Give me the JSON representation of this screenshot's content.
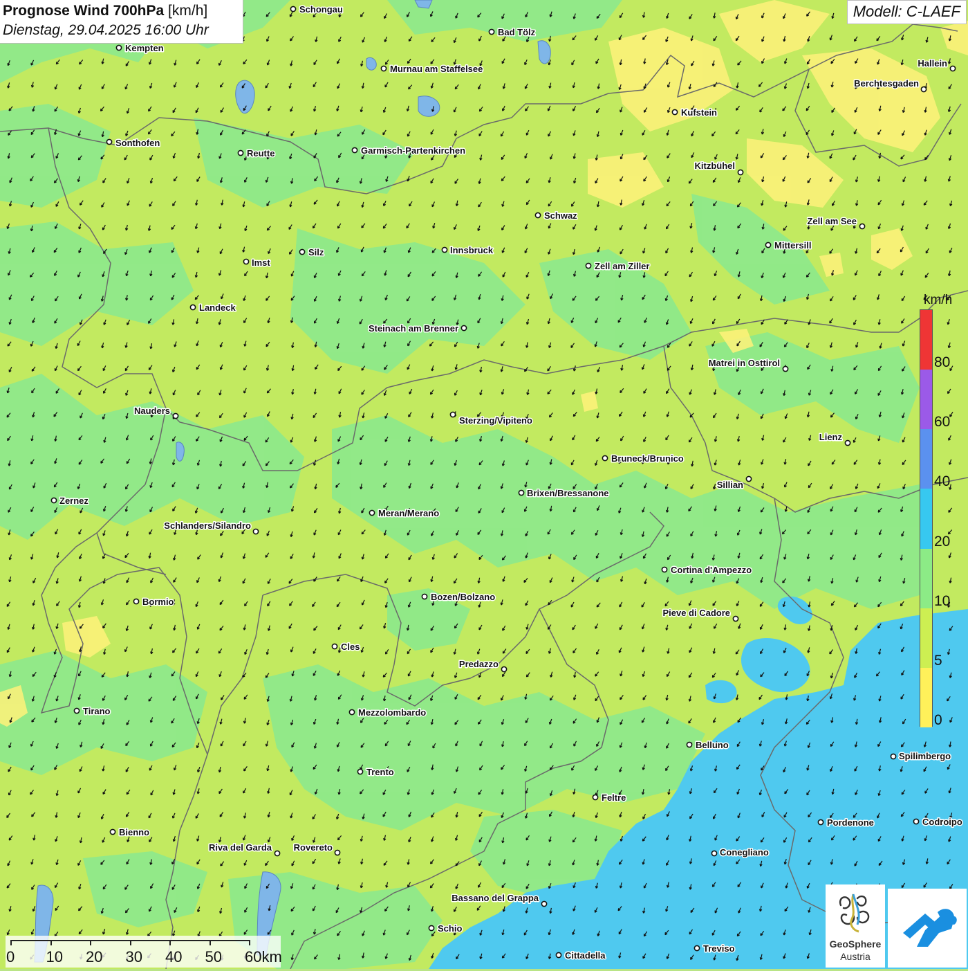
{
  "header": {
    "title_bold": "Prognose Wind 700hPa",
    "title_unit": "[km/h]",
    "datetime": "Dienstag, 29.04.2025 16:00 Uhr",
    "model": "Modell: C-LAEF"
  },
  "legend": {
    "unit": "km/h",
    "ticks": [
      "0",
      "5",
      "10",
      "20",
      "40",
      "60",
      "80"
    ],
    "colors": [
      "#fff15a",
      "#cdef52",
      "#8ceb86",
      "#37c8f0",
      "#5b91ef",
      "#9b5ae8",
      "#ef3535"
    ]
  },
  "scalebar": {
    "labels": [
      "0",
      "10",
      "20",
      "30",
      "40",
      "50",
      "60km"
    ]
  },
  "logos": {
    "geosphere_name": "GeoSphere",
    "geosphere_sub": "Austria"
  },
  "colors": {
    "calm": "#fff15a",
    "light": "#cdef52",
    "moderate": "#8ceb86",
    "fresh": "#45c9ef",
    "border": "#666666",
    "arrow": "#111111"
  },
  "cities": [
    {
      "name": "Schongau"
    },
    {
      "name": "Bad Tölz"
    },
    {
      "name": "Kempten"
    },
    {
      "name": "Murnau am Staffelsee"
    },
    {
      "name": "Hallein"
    },
    {
      "name": "Berchtesgaden"
    },
    {
      "name": "Kufstein"
    },
    {
      "name": "Sonthofen"
    },
    {
      "name": "Reutte"
    },
    {
      "name": "Garmisch-Partenkirchen"
    },
    {
      "name": "Kitzbühel"
    },
    {
      "name": "Schwaz"
    },
    {
      "name": "Zell am See"
    },
    {
      "name": "Mittersill"
    },
    {
      "name": "Silz"
    },
    {
      "name": "Innsbruck"
    },
    {
      "name": "Imst"
    },
    {
      "name": "Zell am Ziller"
    },
    {
      "name": "Landeck"
    },
    {
      "name": "Steinach am Brenner"
    },
    {
      "name": "Matrei in Osttirol"
    },
    {
      "name": "Nauders"
    },
    {
      "name": "Sterzing/Vipiteno"
    },
    {
      "name": "Lienz"
    },
    {
      "name": "Bruneck/Brunico"
    },
    {
      "name": "Sillian"
    },
    {
      "name": "Brixen/Bressanone"
    },
    {
      "name": "Zernez"
    },
    {
      "name": "Meran/Merano"
    },
    {
      "name": "Schlanders/Silandro"
    },
    {
      "name": "Cortina d'Ampezzo"
    },
    {
      "name": "Bormio"
    },
    {
      "name": "Bozen/Bolzano"
    },
    {
      "name": "Pieve di Cadore"
    },
    {
      "name": "Cles"
    },
    {
      "name": "Predazzo"
    },
    {
      "name": "Tirano"
    },
    {
      "name": "Mezzolombardo"
    },
    {
      "name": "Belluno"
    },
    {
      "name": "Spilimbergo"
    },
    {
      "name": "Trento"
    },
    {
      "name": "Feltre"
    },
    {
      "name": "Pordenone"
    },
    {
      "name": "Codroipo"
    },
    {
      "name": "Bienno"
    },
    {
      "name": "Riva del Garda"
    },
    {
      "name": "Rovereto"
    },
    {
      "name": "Conegliano"
    },
    {
      "name": "Bassano del Grappa"
    },
    {
      "name": "Schio"
    },
    {
      "name": "Treviso"
    },
    {
      "name": "Cittadella"
    }
  ]
}
